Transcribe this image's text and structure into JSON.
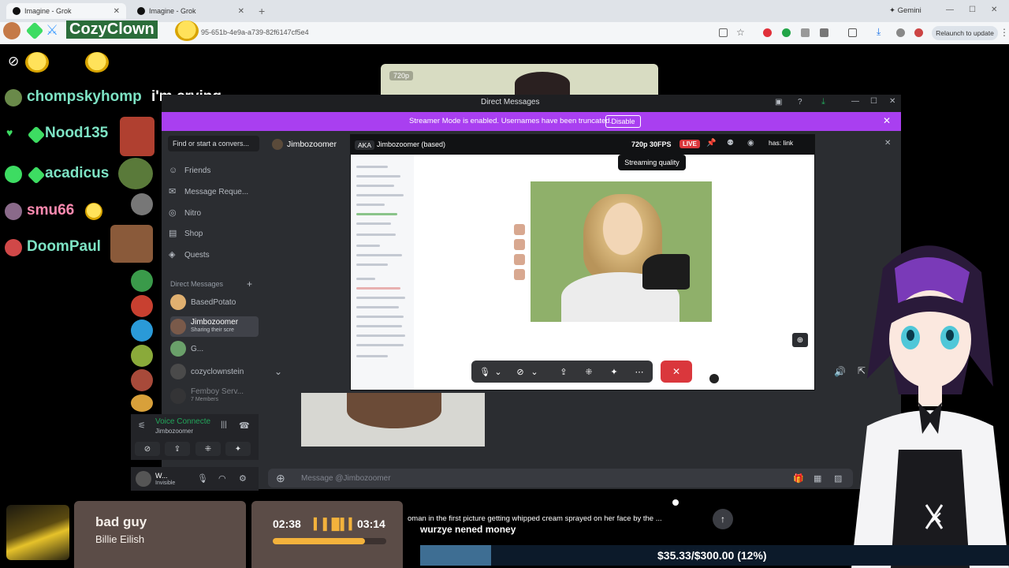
{
  "browser": {
    "tabs": [
      {
        "title": "Imagine - Grok"
      },
      {
        "title": "Imagine - Grok"
      }
    ],
    "url": "95-651b-4e9a-a739-82f6147cf5e4",
    "gemini_label": "Gemini",
    "relaunch_label": "Relaunch to update"
  },
  "chat": {
    "top_user": "CozyClown",
    "messages": [
      {
        "user": "chompskyhomp",
        "text": "i'm crying"
      },
      {
        "user": "Nood135",
        "text": ""
      },
      {
        "user": "acadicus",
        "text": ""
      },
      {
        "user": "smu66",
        "text": ""
      },
      {
        "user": "DoomPaul",
        "text": ""
      }
    ]
  },
  "discord": {
    "window_title": "Direct Messages",
    "banner_text": "Streamer Mode is enabled. Usernames have been truncated.",
    "banner_button": "Disable",
    "search_placeholder": "Find or start a convers...",
    "nav": [
      {
        "label": "Friends",
        "icon": "friends-icon"
      },
      {
        "label": "Message Reque...",
        "icon": "mail-icon"
      },
      {
        "label": "Nitro",
        "icon": "nitro-icon"
      },
      {
        "label": "Shop",
        "icon": "shop-icon"
      },
      {
        "label": "Quests",
        "icon": "quests-icon"
      }
    ],
    "dm_header": "Direct Messages",
    "dms": [
      {
        "name": "BasedPotato",
        "sub": "",
        "color": "#e0b070"
      },
      {
        "name": "Jimbozoomer",
        "sub": "Sharing their scre",
        "color": "#7a5a4a"
      },
      {
        "name": "G...",
        "sub": "",
        "color": "#6aa06a"
      },
      {
        "name": "cozyclownstein",
        "sub": "",
        "color": "#4a4a4a"
      },
      {
        "name": "Femboy Serv...",
        "sub": "7 Members",
        "color": "#3a3a3a"
      }
    ],
    "voice": {
      "status": "Voice Connecte",
      "channel": "Jimbozoomer"
    },
    "user": {
      "name": "W...",
      "status": "Invisible"
    },
    "header_name": "Jimbozoomer",
    "stream": {
      "aka_label": "AKA",
      "aka_name": "Jimbozoomer (based)",
      "quality": "720p 30FPS",
      "live": "LIVE",
      "tooltip": "Streaming quality",
      "search_chip": "has: link"
    },
    "webcam_top_label": "720p",
    "message_placeholder": "Message @Jimbozoomer"
  },
  "music": {
    "title": "bad guy",
    "artist": "Billie Eilish",
    "elapsed": "02:38",
    "total": "03:14",
    "progress": 0.81
  },
  "ticker": {
    "top": "oman in the first picture getting whipped cream sprayed on her face by the ...",
    "bottom": "wurzye nened money"
  },
  "goal": {
    "text": "$35.33/$300.00 (12%)",
    "progress": 0.12
  }
}
